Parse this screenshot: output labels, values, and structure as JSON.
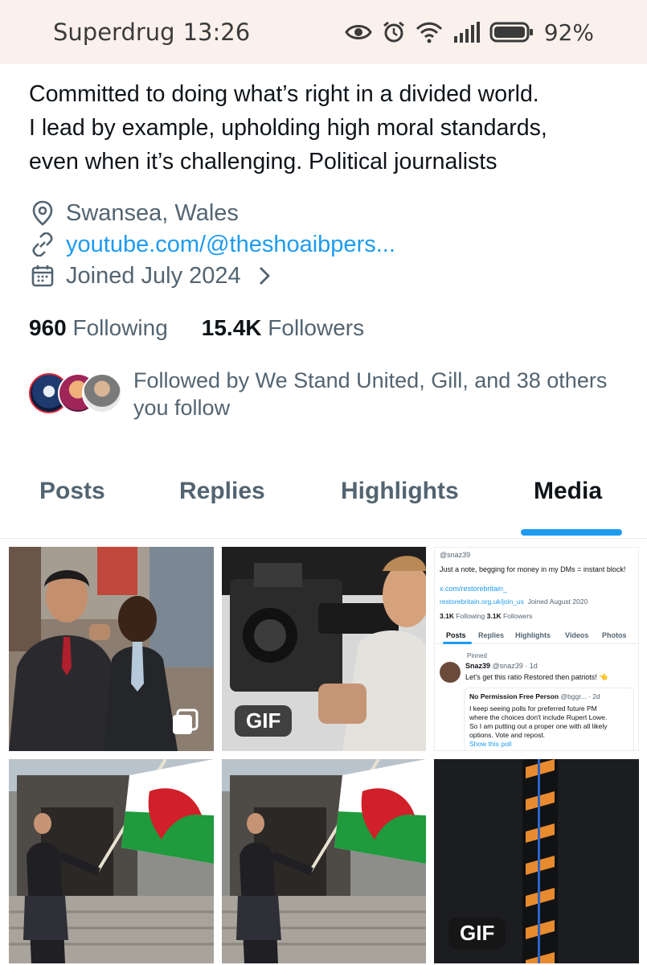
{
  "status_bar": {
    "carrier": "Superdrug",
    "time": "13:26",
    "battery": "92%"
  },
  "profile": {
    "bio_lines": [
      "Committed to doing what’s right in a divided world.",
      "I lead by example, upholding high moral standards,",
      "even when it’s challenging. Political journalists"
    ],
    "location": "Swansea, Wales",
    "website": "youtube.com/@theshoaibpers...",
    "joined": "Joined July 2024",
    "following_count": "960",
    "following_label": "Following",
    "followers_count": "15.4K",
    "followers_label": "Followers",
    "followed_by_line1": "Followed by We Stand United, Gill, and 38 others",
    "followed_by_line2": "you follow"
  },
  "tabs": [
    {
      "label": "Posts"
    },
    {
      "label": "Replies"
    },
    {
      "label": "Highlights"
    },
    {
      "label": "Media"
    }
  ],
  "media": {
    "gif_label": "GIF",
    "screenshot": {
      "handle": "@snaz39",
      "bio": "Just a note, begging for money in my DMs = instant block!",
      "link1": "x.com/restorebritain_",
      "link2": "restorebritain.org.uk/join_us",
      "joined": "Joined August 2020",
      "following": "3.1K",
      "following_label": "Following",
      "followers": "3.1K",
      "followers_label": "Followers",
      "tabs": [
        "Posts",
        "Replies",
        "Highlights",
        "Videos",
        "Photos"
      ],
      "pinned": "Pinned",
      "author": "Snaz39",
      "author_handle": "@snaz39 · 1d",
      "post_text": "Let's get this ratio Restored then patriots! 👈",
      "quoted_author": "No Permission Free Person",
      "quoted_handle": "@bggr... · 2d",
      "quoted_lines": [
        "I keep seeing polls for preferred future PM",
        "where the choices don't include Rupert Lowe.",
        "So I am putting out a proper one with all likely",
        "options. Vote and repost."
      ],
      "show_poll": "Show this poll"
    }
  },
  "colors": {
    "accent": "#1d9bf0",
    "muted": "#536471",
    "status_bar_bg": "#fbf1ec"
  }
}
